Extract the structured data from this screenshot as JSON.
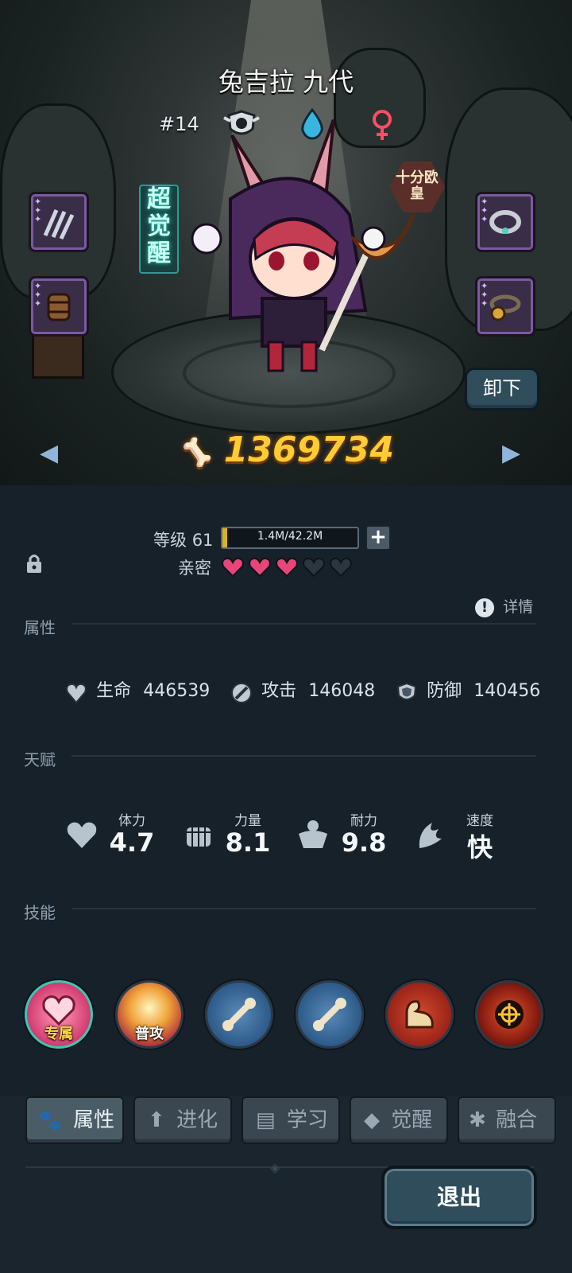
{
  "character": {
    "name": "兔吉拉 九代",
    "number": "#14",
    "power": "1369734"
  },
  "badges": {
    "awaken": "超觉醒",
    "luck": "十分欧皇"
  },
  "buttons": {
    "unequip": "卸下",
    "exit": "退出"
  },
  "level": {
    "label": "等级",
    "value": "61",
    "exp_text": "1.4M/42.2M",
    "exp_fraction": 0.033
  },
  "intimacy": {
    "label": "亲密",
    "hearts_filled": 3,
    "hearts_total": 5
  },
  "details_label": "详情",
  "sections": {
    "attributes": "属性",
    "talent": "天赋",
    "skills": "技能"
  },
  "stats": [
    {
      "label": "生命",
      "value": "446539",
      "icon": "hp-icon"
    },
    {
      "label": "攻击",
      "value": "146048",
      "icon": "attack-icon"
    },
    {
      "label": "防御",
      "value": "140456",
      "icon": "defense-icon"
    }
  ],
  "talents": [
    {
      "label": "体力",
      "value": "4.7",
      "icon": "heart-icon"
    },
    {
      "label": "力量",
      "value": "8.1",
      "icon": "fist-icon"
    },
    {
      "label": "耐力",
      "value": "9.8",
      "icon": "torso-icon"
    },
    {
      "label": "速度",
      "value": "快",
      "icon": "wing-icon"
    }
  ],
  "skills": [
    {
      "caption": "专属",
      "icon": "exclusive-heart-icon"
    },
    {
      "caption": "普攻",
      "icon": "normal-attack-icon"
    },
    {
      "caption": "",
      "icon": "bone-hammer-icon"
    },
    {
      "caption": "",
      "icon": "bone-hammer-icon"
    },
    {
      "caption": "",
      "icon": "flex-arm-icon"
    },
    {
      "caption": "",
      "icon": "target-icon"
    }
  ],
  "tabs": [
    {
      "label": "属性",
      "icon": "paw-icon",
      "active": true
    },
    {
      "label": "进化",
      "icon": "arrow-up-icon",
      "active": false
    },
    {
      "label": "学习",
      "icon": "book-icon",
      "active": false
    },
    {
      "label": "觉醒",
      "icon": "wolf-icon",
      "active": false
    },
    {
      "label": "融合",
      "icon": "fusion-icon",
      "active": false
    }
  ],
  "colors": {
    "power": "#ffcc33",
    "heart_filled": "#e8457a",
    "heart_empty": "#2b3640",
    "panel": "#17212a"
  }
}
